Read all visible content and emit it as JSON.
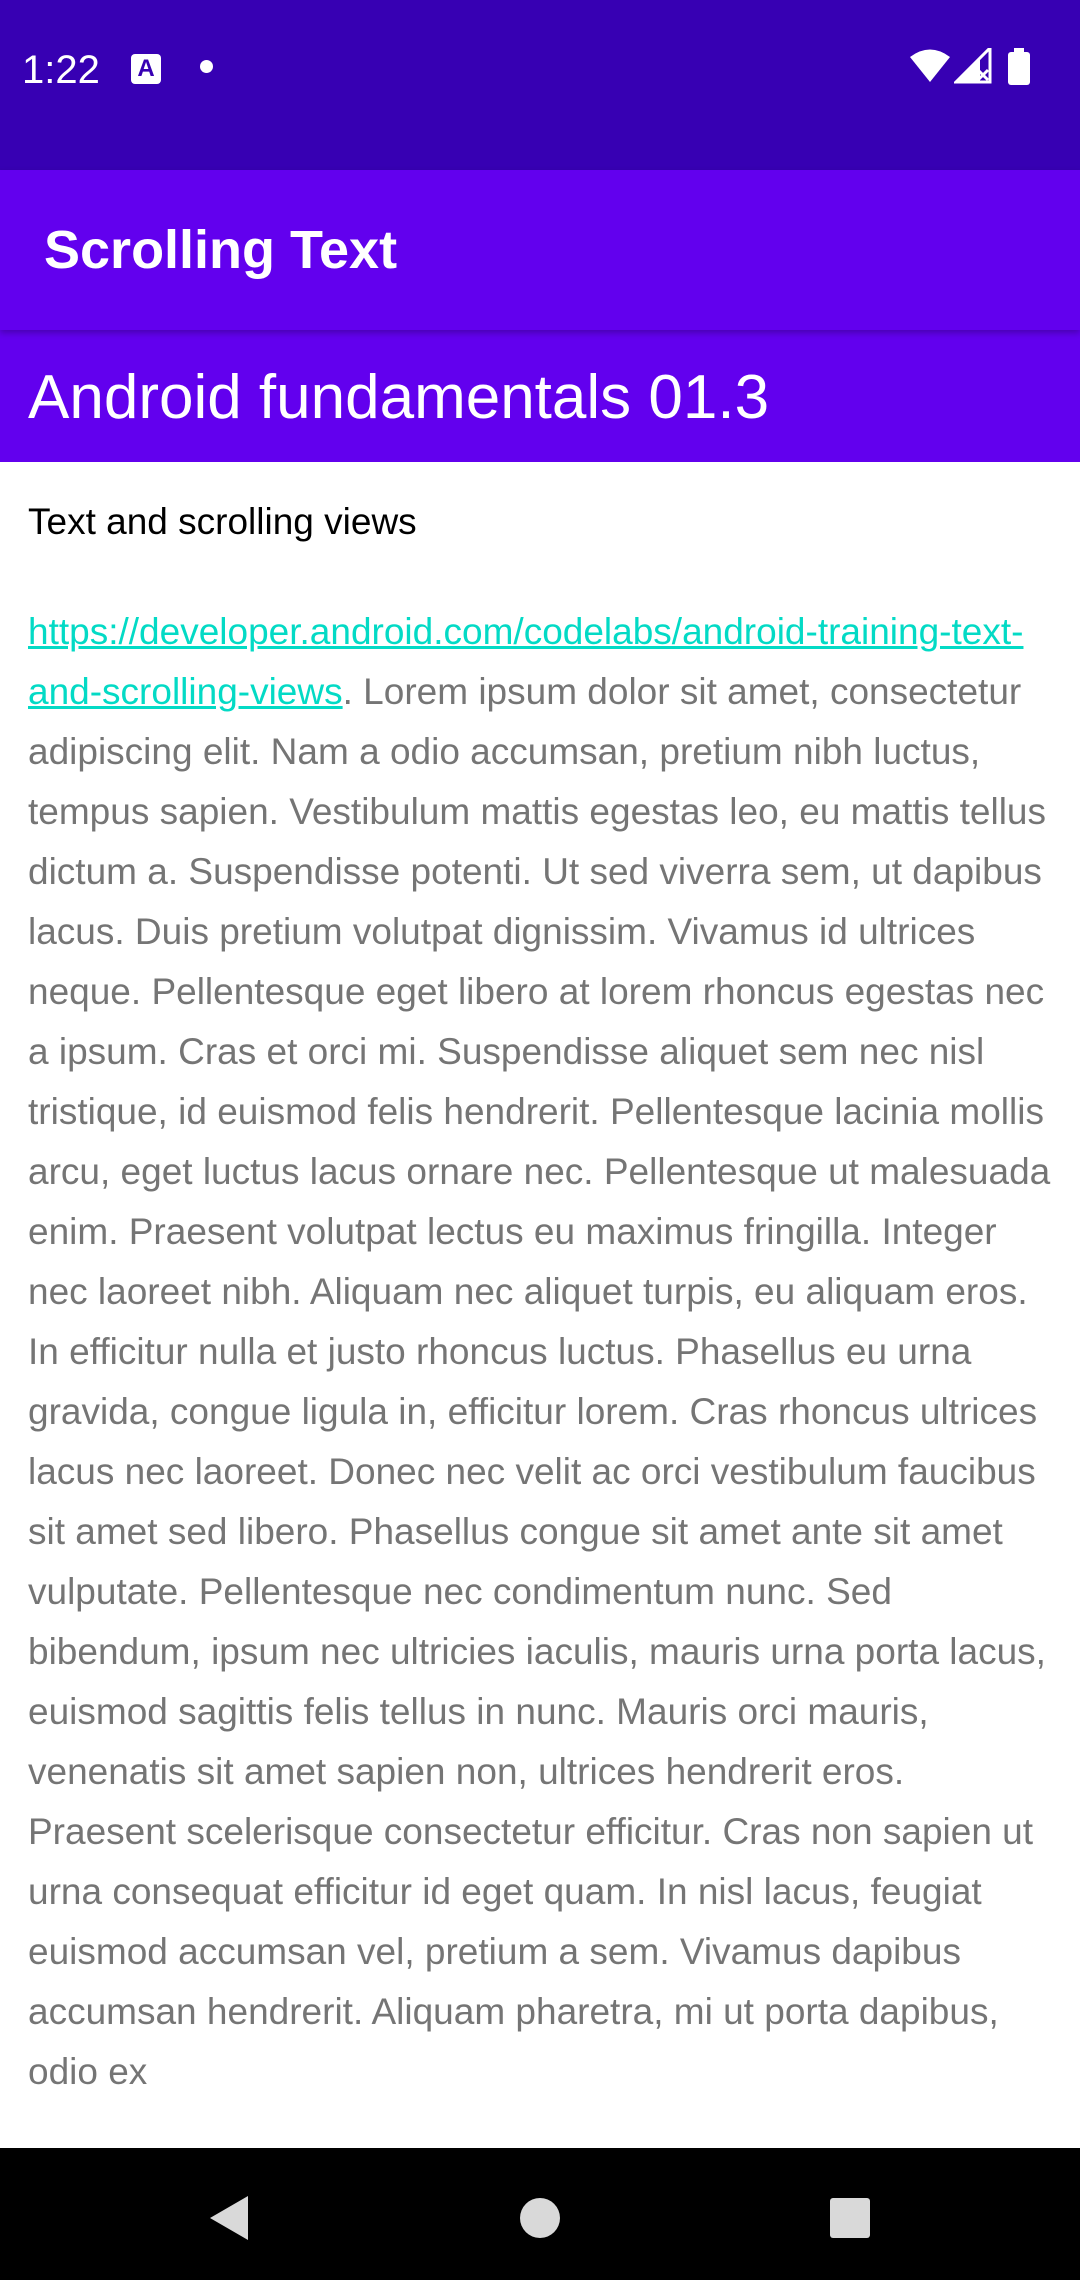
{
  "status_bar": {
    "time": "1:22",
    "a_icon_letter": "A",
    "icons_left": [
      "a-icon",
      "dot-icon"
    ],
    "icons_right": [
      "wifi-icon",
      "signal-icon",
      "battery-icon"
    ]
  },
  "app_bar": {
    "title": "Scrolling Text"
  },
  "heading": {
    "text": "Android fundamentals 01.3"
  },
  "subheading": {
    "text": "Text and scrolling views"
  },
  "article": {
    "link_text": "https://developer.android.com/codelabs/android-training-text-and-scrolling-views",
    "body": ". Lorem ipsum dolor sit amet, consectetur adipiscing elit. Nam a odio accumsan, pretium nibh luctus, tempus sapien. Vestibulum mattis egestas leo, eu mattis tellus dictum a. Suspendisse potenti. Ut sed viverra sem, ut dapibus lacus. Duis pretium volutpat dignissim. Vivamus id ultrices neque. Pellentesque eget libero at lorem rhoncus egestas nec a ipsum. Cras et orci mi. Suspendisse aliquet sem nec nisl tristique, id euismod felis hendrerit. Pellentesque lacinia mollis arcu, eget luctus lacus ornare nec. Pellentesque ut malesuada enim. Praesent volutpat lectus eu maximus fringilla. Integer nec laoreet nibh. Aliquam nec aliquet turpis, eu aliquam eros. In efficitur nulla et justo rhoncus luctus. Phasellus eu urna gravida, congue ligula in, efficitur lorem. Cras rhoncus ultrices lacus nec laoreet. Donec nec velit ac orci vestibulum faucibus sit amet sed libero. Phasellus congue sit amet ante sit amet vulputate. Pellentesque nec condimentum nunc. Sed bibendum, ipsum nec ultricies iaculis, mauris urna porta lacus, euismod sagittis felis tellus in nunc. Mauris orci mauris, venenatis sit amet sapien non, ultrices hendrerit eros. Praesent scelerisque consectetur efficitur. Cras non sapien ut urna consequat efficitur id eget quam. In nisl lacus, feugiat euismod accumsan vel, pretium a sem. Vivamus dapibus accumsan hendrerit. Aliquam pharetra, mi ut porta dapibus, odio ex"
  },
  "nav_bar": {
    "buttons": [
      "back-icon",
      "home-icon",
      "recents-icon"
    ]
  },
  "colors": {
    "status_bar": "#3700b3",
    "primary": "#6200ee",
    "link": "#03dac5",
    "body_text": "#757575"
  }
}
